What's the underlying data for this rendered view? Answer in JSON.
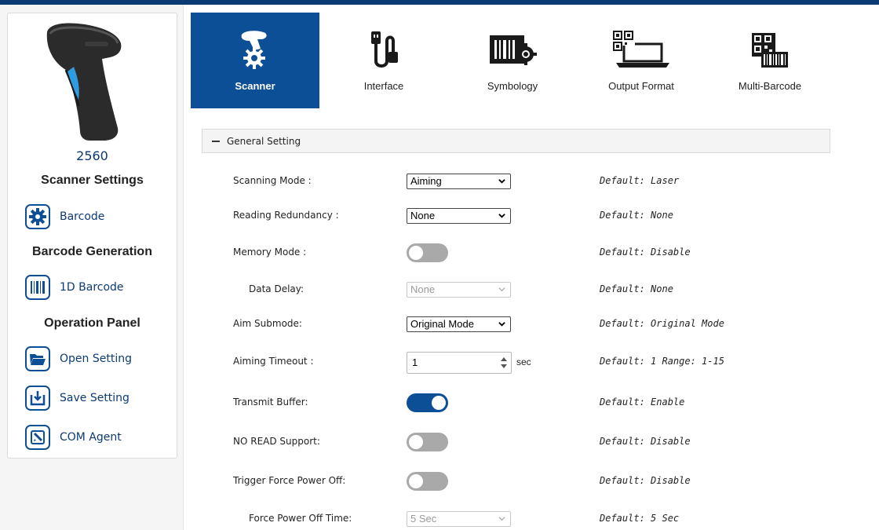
{
  "device": {
    "model": "2560"
  },
  "sidebar": {
    "sections": [
      {
        "title": "Scanner Settings",
        "items": [
          {
            "label": "Barcode",
            "icon": "gear-icon"
          }
        ]
      },
      {
        "title": "Barcode Generation",
        "items": [
          {
            "label": "1D Barcode",
            "icon": "barcode-icon"
          }
        ]
      },
      {
        "title": "Operation Panel",
        "items": [
          {
            "label": "Open Setting",
            "icon": "folder-open-icon"
          },
          {
            "label": "Save Setting",
            "icon": "save-download-icon"
          },
          {
            "label": "COM Agent",
            "icon": "com-agent-icon"
          }
        ]
      }
    ]
  },
  "tabs": [
    {
      "label": "Scanner",
      "icon": "scanner-gear-icon",
      "active": true
    },
    {
      "label": "Interface",
      "icon": "usb-cable-icon",
      "active": false
    },
    {
      "label": "Symbology",
      "icon": "barcode-gear-icon",
      "active": false
    },
    {
      "label": "Output Format",
      "icon": "laptop-qr-icon",
      "active": false
    },
    {
      "label": "Multi-Barcode",
      "icon": "multi-barcode-icon",
      "active": false
    }
  ],
  "general": {
    "title": "General Setting",
    "rows": [
      {
        "label": "Scanning Mode :",
        "control": "select",
        "value": "Aiming",
        "default": "Default: Laser"
      },
      {
        "label": "Reading Redundancy :",
        "control": "select",
        "value": "None",
        "default": "Default: None"
      },
      {
        "label": "Memory Mode :",
        "control": "toggle",
        "on": false,
        "default": "Default: Disable"
      },
      {
        "label": "Data Delay:",
        "control": "select-disabled",
        "value": "None",
        "default": "Default: None"
      },
      {
        "label": "Aim Submode:",
        "control": "select",
        "value": "Original Mode",
        "default": "Default: Original Mode"
      },
      {
        "label": "Aiming Timeout :",
        "control": "number",
        "value": "1",
        "unit": "sec",
        "default": "Default: 1 Range: 1-15"
      },
      {
        "label": "Transmit Buffer:",
        "control": "toggle",
        "on": true,
        "default": "Default: Enable"
      },
      {
        "label": "NO READ Support:",
        "control": "toggle",
        "on": false,
        "default": "Default: Disable"
      },
      {
        "label": "Trigger Force Power Off:",
        "control": "toggle",
        "on": false,
        "default": "Default: Disable"
      },
      {
        "label": "Force Power Off Time:",
        "control": "select-disabled",
        "value": "5 Sec",
        "default": "Default: 5 Sec"
      }
    ]
  },
  "colors": {
    "accent": "#0d4f96",
    "topbar": "#0c3a72",
    "toggle_off": "#a9a9a9"
  }
}
